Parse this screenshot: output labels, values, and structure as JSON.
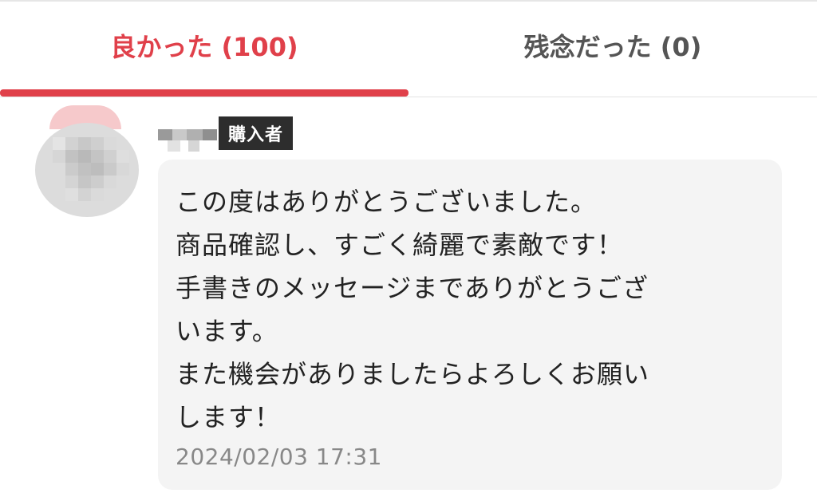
{
  "tabs": {
    "good_label": "良かった (100)",
    "bad_label": "残念だった (0)",
    "active": "good",
    "active_color": "#e0404a",
    "inactive_color": "#555555"
  },
  "review": {
    "badge": "購入者",
    "comment_lines": [
      "この度はありがとうございました。",
      "商品確認し、すごく綺麗で素敵です！",
      "手書きのメッセージまでありがとうござ",
      "います。",
      "また機会がありましたらよろしくお願い",
      "します！"
    ],
    "timestamp": "2024/02/03 17:31"
  }
}
